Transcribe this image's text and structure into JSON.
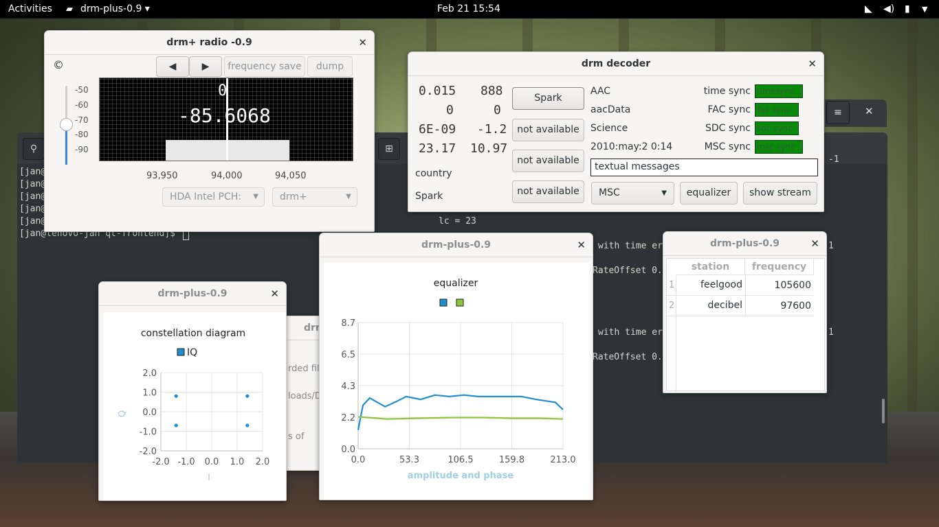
{
  "topbar": {
    "activities": "Activities",
    "app_menu": "drm-plus-0.9 ▾",
    "clock": "Feb 21  15:54"
  },
  "terminal": {
    "lines": [
      "[jan@",
      "[jan@",
      "[jan@",
      "[jan@",
      "[jan@"
    ],
    "prompt": "[jan@lenovo-jan qt-frontend]$ ",
    "mid_lines": [
      "lc = 23"
    ],
    "right_frag": [
      "-1",
      "with time er",
      "1",
      "RateOffset 0.",
      "with time er",
      "1",
      "RateOffset 0."
    ]
  },
  "radio": {
    "title": "drm+ radio -0.9",
    "copyright": "©",
    "prev": "◀",
    "next": "▶",
    "freq_save": "frequency save",
    "dump": "dump",
    "spectrum_value": "-85.6068",
    "spectrum_box": "0",
    "db_ticks": [
      "-50",
      "-60",
      "-70",
      "-80",
      "-90"
    ],
    "freq_ticks": [
      "93,950",
      "94,000",
      "94,050"
    ],
    "device": "HDA Intel PCH:",
    "mode": "drm+"
  },
  "decoder": {
    "title": "drm decoder",
    "left_values": [
      [
        "0.015",
        "888"
      ],
      [
        "0",
        "0"
      ],
      [
        "6E-09",
        "-1.2"
      ],
      [
        "23.17",
        "10.97"
      ]
    ],
    "country": "country",
    "spark": "Spark",
    "spark_btn": "Spark",
    "na1": "not available",
    "na2": "not available",
    "na3": "not available",
    "info": [
      "AAC",
      "aacData",
      "Science",
      "2010:may:2 0:14"
    ],
    "sync_labels": [
      "time sync",
      "FAC sync",
      "SDC sync",
      "MSC sync"
    ],
    "sync_values": [
      "timesync",
      "fac sync",
      "sdc sync",
      "msc sync"
    ],
    "textual": "textual messages",
    "msc": "MSC",
    "equalizer": "equalizer",
    "show_stream": "show stream"
  },
  "constellation": {
    "title": "drm-plus-0.9"
  },
  "behind": {
    "title": "drm",
    "lines": [
      "rded fil",
      "loads/D",
      "s of"
    ]
  },
  "eq_win": {
    "title": "drm-plus-0.9"
  },
  "stations": {
    "title": "drm-plus-0.9",
    "headers": [
      "station",
      "frequency"
    ],
    "rows": [
      {
        "n": "1",
        "station": "feelgood",
        "freq": "105600"
      },
      {
        "n": "2",
        "station": "decibel",
        "freq": "97600"
      }
    ]
  },
  "chart_data": [
    {
      "type": "scatter",
      "title": "constellation diagram",
      "legend": [
        "IQ"
      ],
      "xlabel": "I",
      "ylabel": "Q",
      "xlim": [
        -2,
        2
      ],
      "ylim": [
        -2,
        2
      ],
      "xticks": [
        "-2.0",
        "-1.0",
        "0.0",
        "1.0",
        "2.0"
      ],
      "yticks": [
        "2.0",
        "1.0",
        "0.0",
        "-1.0",
        "-2.0"
      ],
      "grid": true,
      "series": [
        {
          "name": "IQ",
          "color": "#1f8ed0",
          "points": [
            [
              -1.4,
              0.8
            ],
            [
              1.4,
              0.8
            ],
            [
              -1.4,
              -0.7
            ],
            [
              1.4,
              -0.7
            ]
          ]
        }
      ]
    },
    {
      "type": "line",
      "title": "equalizer",
      "xlabel": "amplitude and phase",
      "xlim": [
        0,
        213
      ],
      "ylim": [
        0,
        8.7
      ],
      "xticks": [
        "0.0",
        "53.3",
        "106.5",
        "159.8",
        "213.0"
      ],
      "yticks": [
        "8.7",
        "6.5",
        "4.3",
        "2.2",
        "0.0"
      ],
      "grid": true,
      "legend_position": "top",
      "series": [
        {
          "color": "#1f8ed0",
          "x": [
            0,
            5,
            12,
            20,
            28,
            38,
            50,
            65,
            80,
            95,
            110,
            125,
            140,
            155,
            170,
            185,
            195,
            205,
            213
          ],
          "y": [
            1.3,
            3.0,
            3.5,
            3.2,
            2.9,
            3.2,
            3.6,
            3.4,
            3.7,
            3.6,
            3.7,
            3.6,
            3.6,
            3.6,
            3.6,
            3.4,
            3.3,
            3.2,
            2.7
          ]
        },
        {
          "color": "#8cc63f",
          "x": [
            0,
            10,
            30,
            60,
            100,
            130,
            160,
            190,
            213
          ],
          "y": [
            2.2,
            2.15,
            2.05,
            2.1,
            2.15,
            2.15,
            2.1,
            2.1,
            2.05
          ]
        }
      ]
    }
  ]
}
